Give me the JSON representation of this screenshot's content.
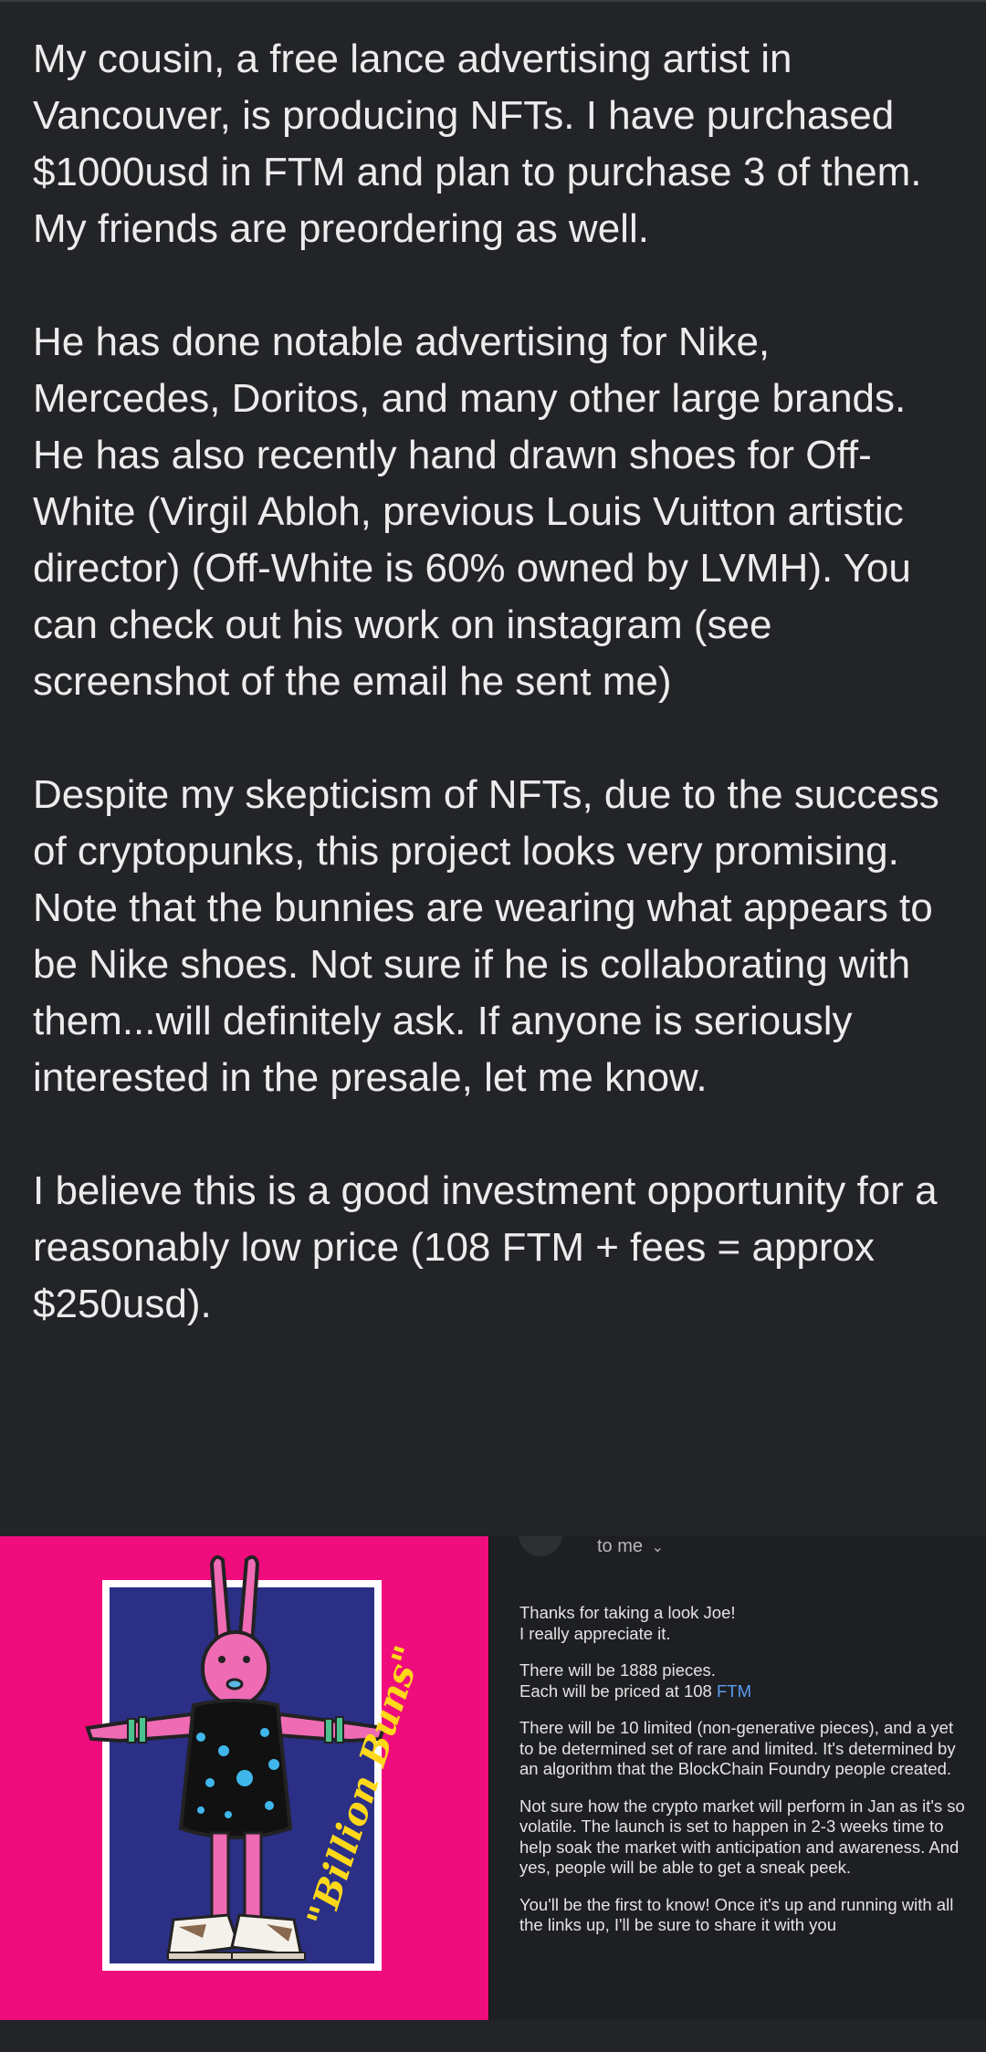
{
  "post": {
    "paragraphs": [
      "My cousin, a free lance advertising artist in Vancouver, is producing NFTs.  I have purchased $1000usd in FTM and plan to purchase 3 of them.  My friends are preordering as well.",
      "He has done notable advertising for Nike, Mercedes, Doritos, and many other large brands.  He has also recently hand drawn shoes for Off-White (Virgil Abloh, previous Louis Vuitton artistic director) (Off-White is 60% owned by LVMH).  You can check out his work on instagram (see screenshot of the email he sent me)",
      "Despite my skepticism of NFTs, due to the success of cryptopunks, this project looks very promising.  Note that the bunnies are wearing what appears to be Nike shoes.  Not sure if he is collaborating with them...will definitely ask.  If anyone is seriously interested in the presale, let me know.",
      "I believe this is a good investment opportunity for a reasonably low price (108 FTM + fees = approx $250usd)."
    ]
  },
  "artwork": {
    "signature": "\"Billion Buns\"",
    "background_color": "#ef0c7c",
    "accent_color": "#ffd81a"
  },
  "email": {
    "recipient_label": "to me",
    "lines": {
      "greeting_1": "Thanks for taking a look Joe!",
      "greeting_2": "I really appreciate it.",
      "pieces": "There will be 1888 pieces.",
      "price_prefix": "Each will be priced at 108 ",
      "price_link": "FTM",
      "limited": "There will be 10 limited (non-generative pieces), and a yet to be determined set of rare and limited. It's determined by an algorithm that the BlockChain Foundry people created.",
      "market": "Not sure how the crypto market will perform in Jan as it's so volatile. The launch is set to happen in 2-3 weeks time to help soak the market with anticipation and awareness. And yes, people will be able to get a sneak peek.",
      "closing": "You'll be the first to know! Once it's up and running with all the links up, I'll be sure to share it with you"
    },
    "link_color": "#5b9cf2"
  }
}
